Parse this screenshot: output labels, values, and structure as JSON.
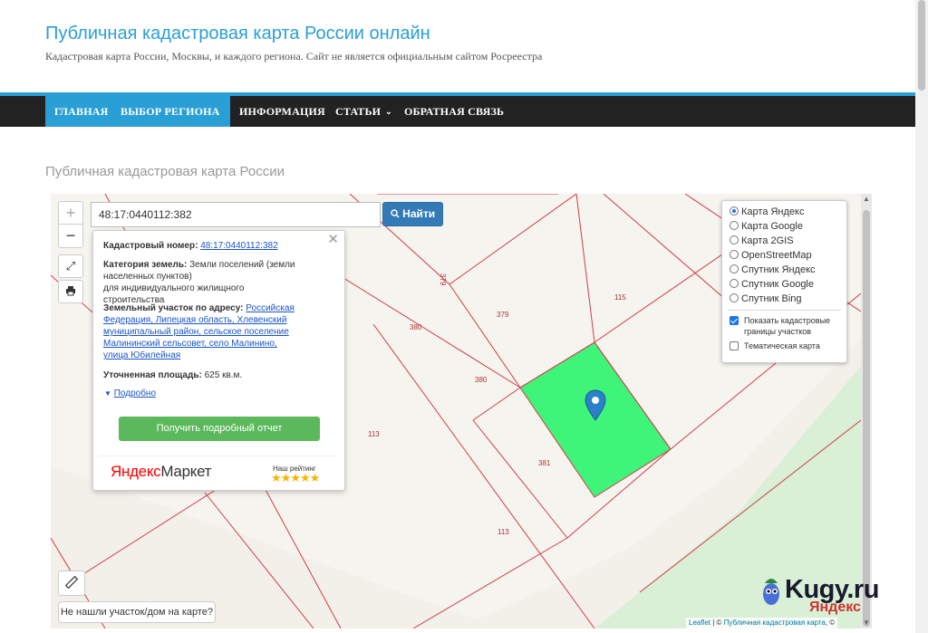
{
  "header": {
    "title": "Публичная кадастровая карта России онлайн",
    "description": "Кадастровая карта России, Москвы, и каждого региона. Сайт не является официальным сайтом Росреестра"
  },
  "nav": {
    "items": [
      {
        "label": "ГЛАВНАЯ"
      },
      {
        "label": "ВЫБОР РЕГИОНА"
      },
      {
        "label": "ИНФОРМАЦИЯ"
      },
      {
        "label": "СТАТЬИ"
      },
      {
        "label": "ОБРАТНАЯ СВЯЗЬ"
      }
    ]
  },
  "page": {
    "heading": "Публичная кадастровая карта России"
  },
  "search": {
    "value": "48:17:0440112:382",
    "button": "Найти"
  },
  "zoom": {
    "in": "+",
    "out": "−"
  },
  "popup": {
    "cad_label": "Кадастровый номер:",
    "cad_number": "48:17:0440112:382",
    "cat_label": "Категория земель:",
    "cat_value": "Земли поселений (земли населенных пунктов)",
    "cat_use": "для индивидуального жилищного строительства",
    "addr_label": "Земельный участок по адресу:",
    "addr_value": "Российская Федерация, Липецкая область, Хлевенский муниципальный район, сельское поселение Малининский сельсовет, село Малинино, улица Юбилейная",
    "area_label": "Уточненная площадь:",
    "area_value": "625 кв.м.",
    "more": "Подробно",
    "report_button": "Получить подробный отчет",
    "ym_logo_a": "Яндекс",
    "ym_logo_b": "Маркет",
    "ym_rating": "Наш рейтинг",
    "ym_stars": "★★★★★"
  },
  "layers": {
    "options": [
      {
        "label": "Карта Яндекс",
        "selected": true
      },
      {
        "label": "Карта Google",
        "selected": false
      },
      {
        "label": "Карта 2GIS",
        "selected": false
      },
      {
        "label": "OpenStreetMap",
        "selected": false
      },
      {
        "label": "Спутник Яндекс",
        "selected": false
      },
      {
        "label": "Спутник Google",
        "selected": false
      },
      {
        "label": "Спутник Bing",
        "selected": false
      }
    ],
    "cadastre_label": "Показать кадастровые границы участков",
    "cadastre_checked": true,
    "thematic_label": "Тематическая карта",
    "thematic_checked": false
  },
  "map": {
    "parcel_labels": [
      "379",
      "115",
      "380",
      "379",
      "380",
      "113",
      "381",
      "113"
    ],
    "highlight_color": "#3ef57a",
    "parcel_line_color": "#d13b4a",
    "not_found": "Не нашли участок/дом на карте?",
    "attribution_leaflet": "Leaflet",
    "attribution_sep": " | © ",
    "attribution_link": "Публичная кадастровая карта",
    "attribution_tail": ", ©",
    "yandex_watermark": "Яндекс"
  },
  "watermark": {
    "text": "Kugy.ru"
  }
}
